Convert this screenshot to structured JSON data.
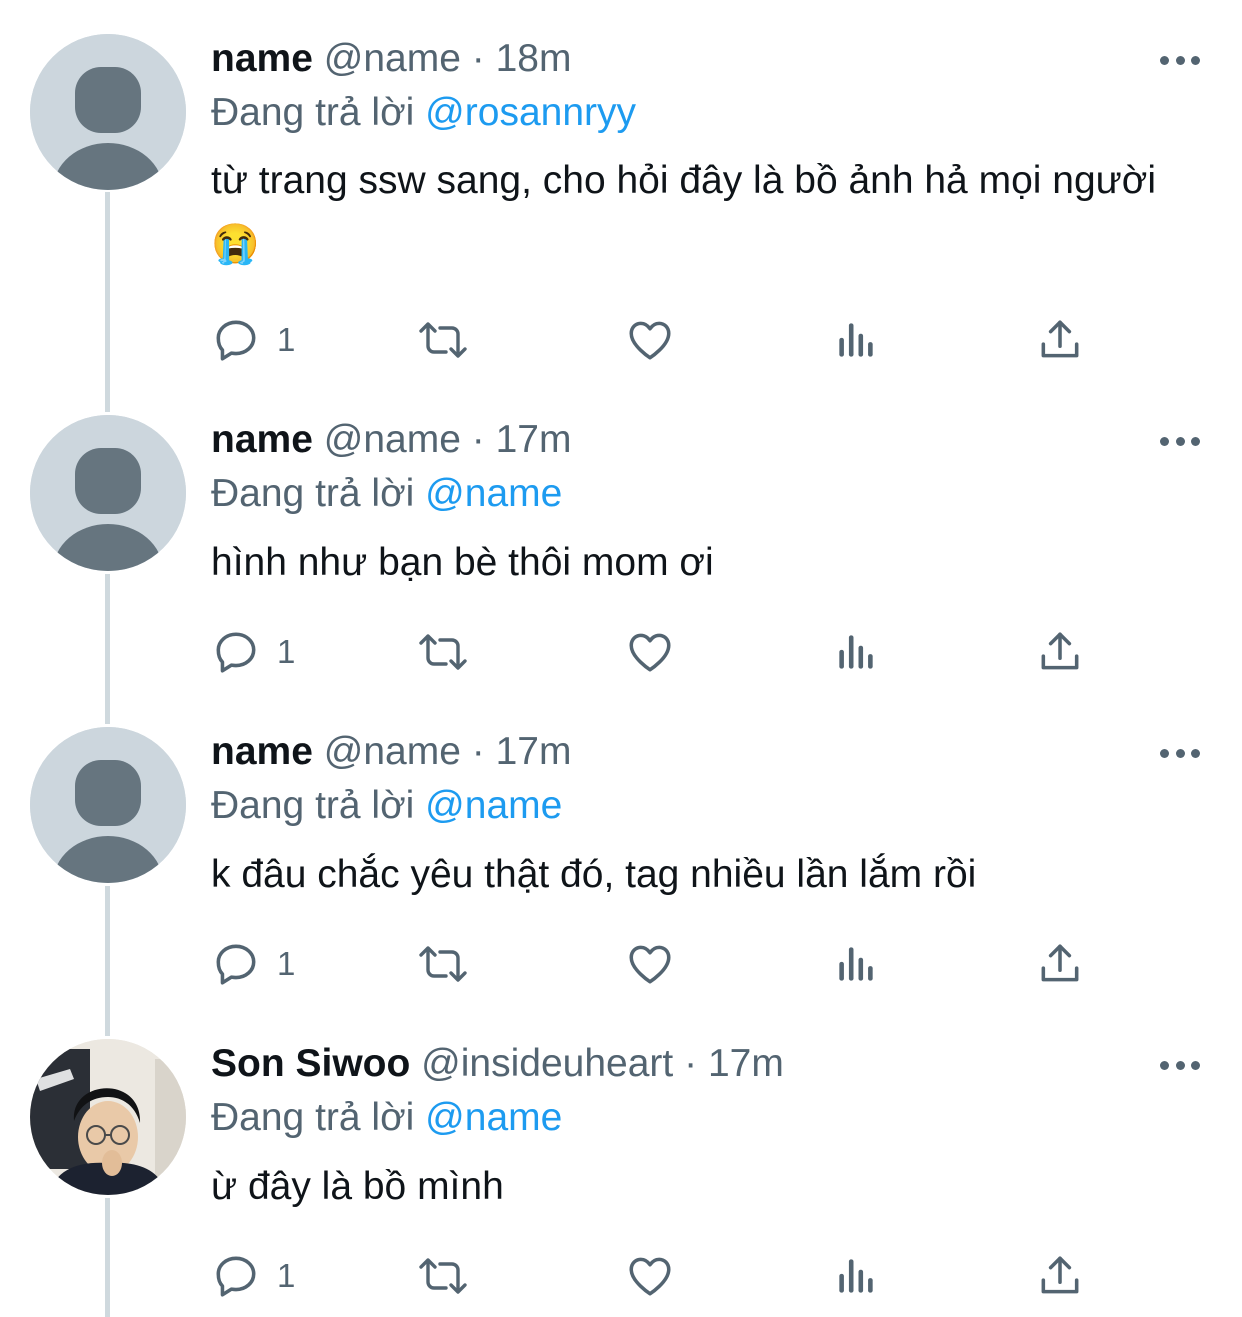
{
  "tweets": [
    {
      "display_name": "name",
      "handle": "@name",
      "separator": "·",
      "time": "18m",
      "reply_prefix": "Đang trả lời ",
      "reply_to": "@rosannryy",
      "text": "từ trang ssw sang, cho hỏi đây là bồ ảnh hả mọi người 😭",
      "reply_count": "1",
      "avatar": "default-avatar-icon"
    },
    {
      "display_name": "name",
      "handle": "@name",
      "separator": "·",
      "time": "17m",
      "reply_prefix": "Đang trả lời ",
      "reply_to": "@name",
      "text": "hình như bạn bè thôi mom ơi",
      "reply_count": "1",
      "avatar": "default-avatar-icon"
    },
    {
      "display_name": "name",
      "handle": "@name",
      "separator": "·",
      "time": "17m",
      "reply_prefix": "Đang trả lời ",
      "reply_to": "@name",
      "text": "k đâu chắc yêu thật đó, tag nhiều lần lắm rồi",
      "reply_count": "1",
      "avatar": "default-avatar-icon"
    },
    {
      "display_name": "Son Siwoo",
      "handle": "@insideuheart",
      "separator": "·",
      "time": "17m",
      "reply_prefix": "Đang trả lời ",
      "reply_to": "@name",
      "text": "ừ đây là bồ mình",
      "reply_count": "1",
      "avatar": "profile-photo"
    }
  ],
  "colors": {
    "text_primary": "#0f1419",
    "text_secondary": "#536471",
    "accent": "#1d9bf0",
    "thread_line": "#cfd9de",
    "avatar_bg": "#ccd6dd",
    "avatar_figure": "#66757f"
  },
  "icons": [
    "more-icon",
    "reply-icon",
    "retweet-icon",
    "like-icon",
    "views-icon",
    "share-icon"
  ]
}
